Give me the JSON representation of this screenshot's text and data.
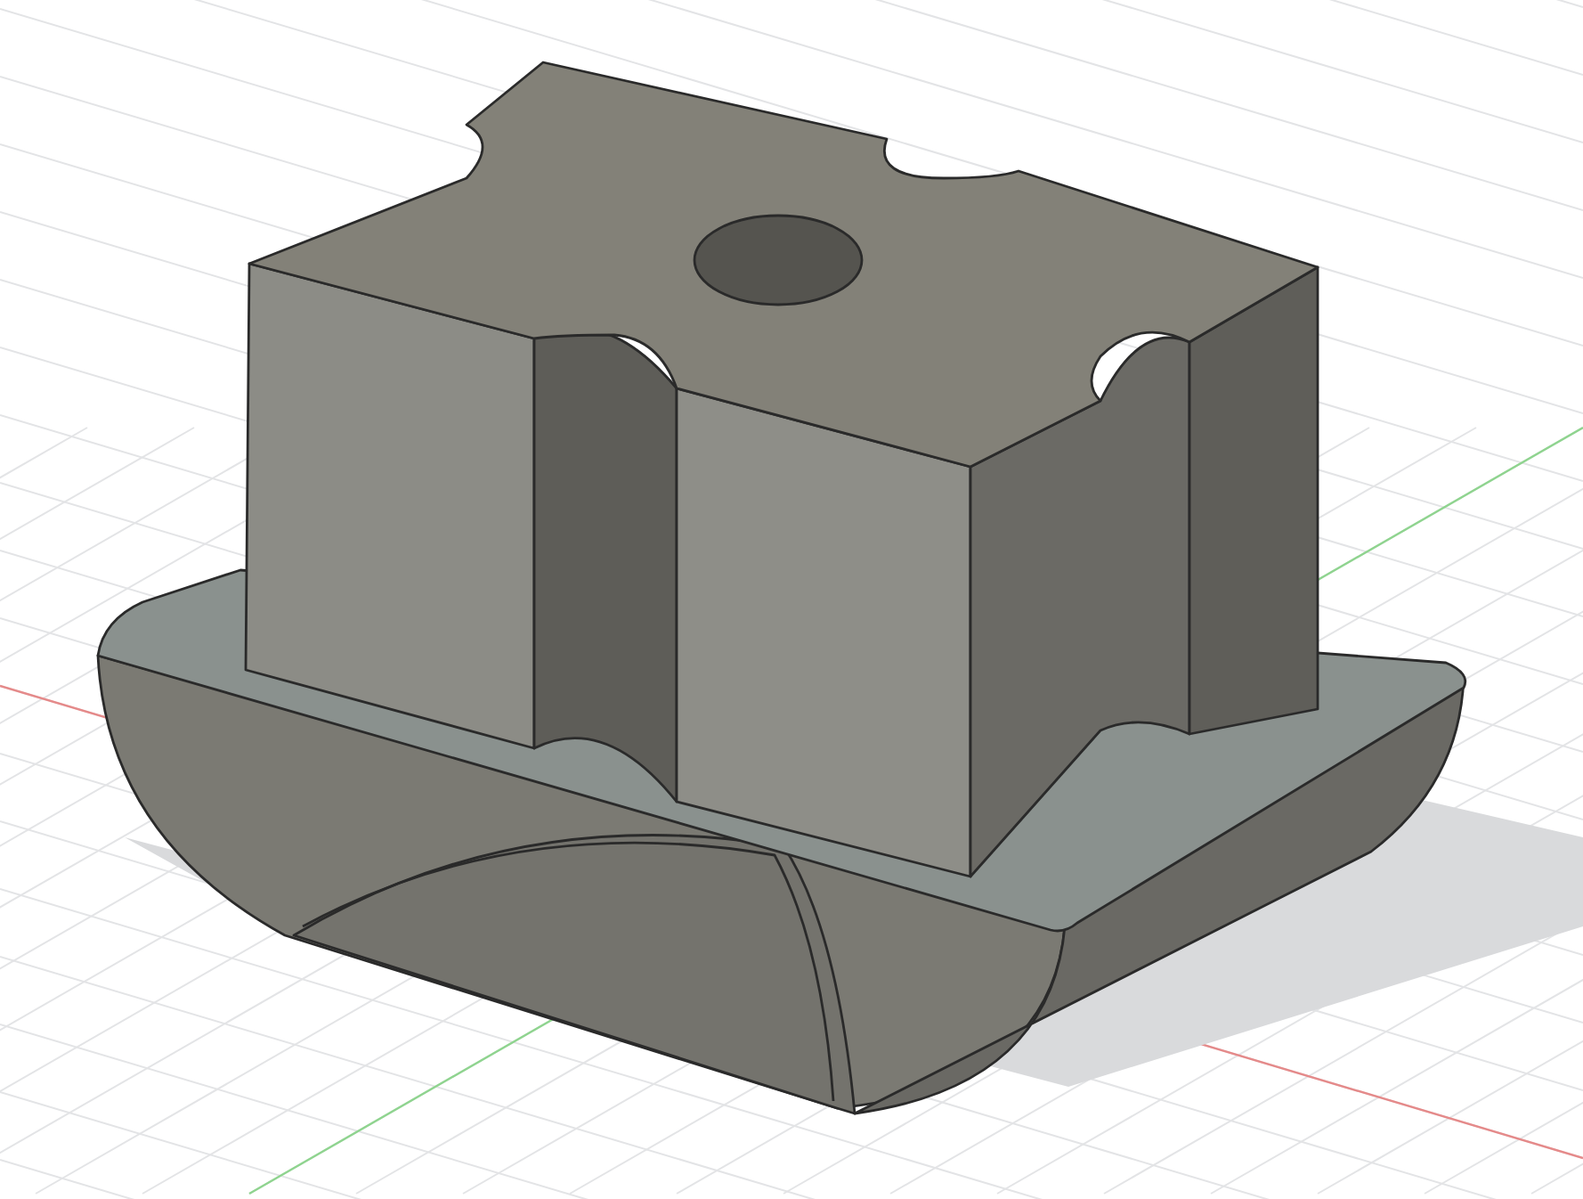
{
  "viewport": {
    "kind": "cad-model"
  }
}
